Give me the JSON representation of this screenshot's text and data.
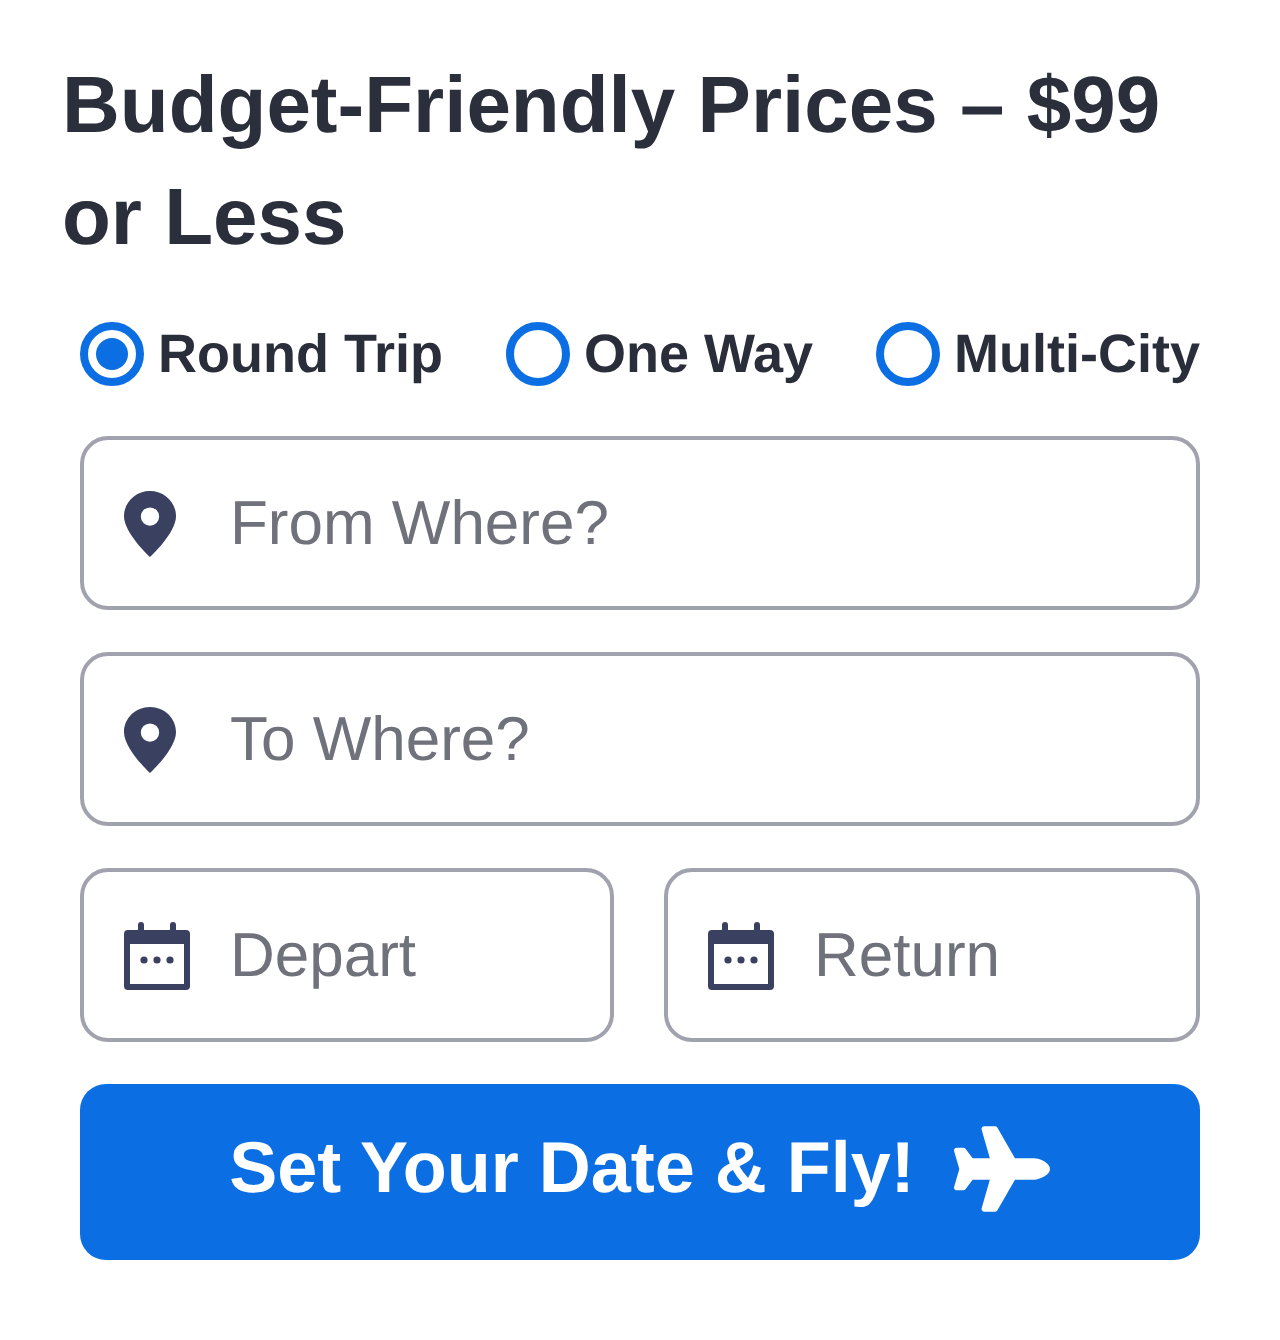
{
  "title": "Budget-Friendly Prices – $99 or Less",
  "trip_types": [
    {
      "label": "Round Trip",
      "selected": true
    },
    {
      "label": "One Way",
      "selected": false
    },
    {
      "label": "Multi-City",
      "selected": false
    }
  ],
  "fields": [
    {
      "kind": "location",
      "placeholder": "From Where?"
    },
    {
      "kind": "location",
      "placeholder": "To Where?"
    },
    {
      "kind": "date",
      "placeholder": "Depart"
    },
    {
      "kind": "date",
      "placeholder": "Return"
    }
  ],
  "submit_button": {
    "label": "Set Your Date & Fly!"
  }
}
